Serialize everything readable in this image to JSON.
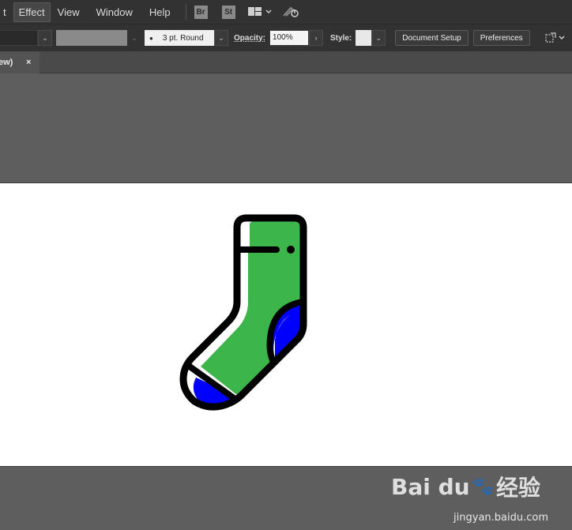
{
  "menubar": {
    "items": [
      "t",
      "Effect",
      "View",
      "Window",
      "Help"
    ],
    "active_index": 1,
    "app_badges": [
      "Br",
      "St"
    ]
  },
  "controlbar": {
    "stroke_weight": "3 pt. Round",
    "opacity_label": "Opacity:",
    "opacity_value": "100%",
    "style_label": "Style:",
    "document_setup": "Document Setup",
    "preferences": "Preferences"
  },
  "tab": {
    "name": "ew)",
    "close": "×"
  },
  "watermark": {
    "brand": "Bai du",
    "brand_cn": "经验",
    "url": "jingyan.baidu.com"
  },
  "colors": {
    "sock_green": "#3cb54a",
    "sock_blue": "#0000ff",
    "outline": "#000000",
    "ui_dark": "#323232",
    "canvas_gray": "#5e5e5e"
  }
}
